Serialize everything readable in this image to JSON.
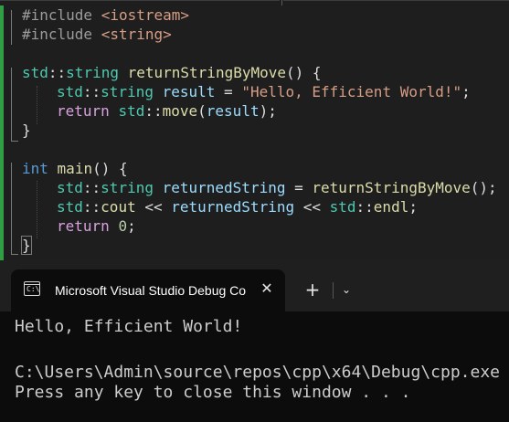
{
  "editor": {
    "lines": {
      "l1": {
        "pp": "#include",
        "hdr": "<iostream>"
      },
      "l2": {
        "pp": "#include",
        "hdr": "<string>"
      },
      "l3": {
        "ns": "std",
        "sep": "::",
        "type": "string",
        "fn": "returnStringByMove",
        "rest": "() {"
      },
      "l4": {
        "ns": "std",
        "sep": "::",
        "type": "string",
        "var": "result",
        "eq": " = ",
        "str": "\"Hello, Efficient World!\"",
        "end": ";"
      },
      "l5": {
        "kw": "return",
        "ns": "std",
        "sep": "::",
        "fn": "move",
        "open": "(",
        "var": "result",
        "end": ");"
      },
      "l6": {
        "text": "}"
      },
      "l7": {
        "kw": "int",
        "fn": "main",
        "rest": "() {"
      },
      "l8": {
        "ns": "std",
        "sep": "::",
        "type": "string",
        "var": "returnedString",
        "eq": " = ",
        "fn": "returnStringByMove",
        "end": "();"
      },
      "l9": {
        "ns": "std",
        "sep": "::",
        "fn": "cout",
        "op": " << ",
        "var": "returnedString",
        "op2": " << ",
        "ns2": "std",
        "sep2": "::",
        "fn2": "endl",
        "end": ";"
      },
      "l10": {
        "kw": "return",
        "num": "0",
        "end": ";"
      },
      "l11": {
        "text": "}"
      }
    }
  },
  "terminal": {
    "tab_title": "Microsoft Visual Studio Debug Console",
    "tab_icon_text": "C:\\",
    "close_glyph": "✕",
    "new_tab_glyph": "+",
    "dropdown_glyph": "⌄",
    "output": [
      "Hello, Efficient World!",
      "",
      "C:\\Users\\Admin\\source\\repos\\cpp\\x64\\Debug\\cpp.exe",
      "Press any key to close this window . . ."
    ]
  }
}
